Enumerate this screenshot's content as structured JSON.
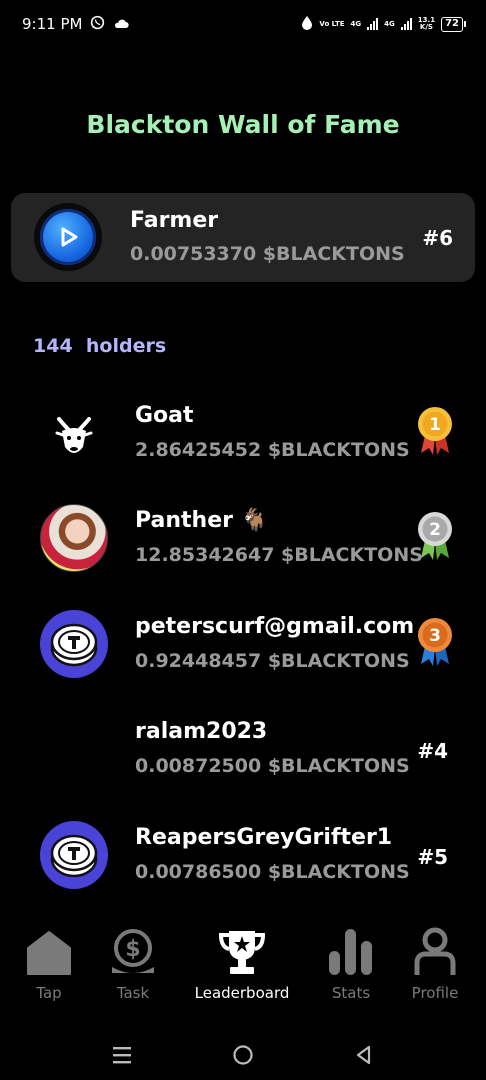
{
  "status_bar": {
    "time": "9:11 PM",
    "volte": "Vo LTE",
    "net1": "4G",
    "net2": "4G",
    "speed_value": "13.1",
    "speed_unit": "K/S",
    "battery": "72",
    "icons": [
      "whatsapp-icon",
      "cloud-icon",
      "data-saver-icon",
      "signal-icon",
      "battery-icon"
    ]
  },
  "page": {
    "title": "Blackton Wall of Fame"
  },
  "my_entry": {
    "name": "Farmer",
    "balance": "0.00753370 $BLACKTONS",
    "rank": "#6",
    "avatar": "blue-play-coin-avatar"
  },
  "holders": {
    "count": "144",
    "label": "holders"
  },
  "leaderboard": [
    {
      "name": "Goat",
      "balance": "2.86425452 $BLACKTONS",
      "rank": "1",
      "badge": "gold-medal-icon",
      "avatar": "goat-avatar"
    },
    {
      "name": "Panther 🐐",
      "balance": "12.85342647 $BLACKTONS",
      "rank": "2",
      "badge": "silver-medal-icon",
      "avatar": "photo-avatar"
    },
    {
      "name": "peterscurf@gmail.com",
      "balance": "0.92448457 $BLACKTONS",
      "rank": "3",
      "badge": "bronze-medal-icon",
      "avatar": "coin-avatar"
    },
    {
      "name": "ralam2023",
      "balance": "0.00872500 $BLACKTONS",
      "rank": "#4",
      "avatar": ""
    },
    {
      "name": "ReapersGreyGrifter1",
      "balance": "0.00786500 $BLACKTONS",
      "rank": "#5",
      "avatar": "coin-avatar"
    }
  ],
  "nav": {
    "items": [
      {
        "label": "Tap",
        "icon": "home-icon",
        "active": false
      },
      {
        "label": "Task",
        "icon": "dollar-coin-icon",
        "active": false
      },
      {
        "label": "Leaderboard",
        "icon": "trophy-icon",
        "active": true
      },
      {
        "label": "Stats",
        "icon": "bar-chart-icon",
        "active": false
      },
      {
        "label": "Profile",
        "icon": "person-icon",
        "active": false
      }
    ]
  },
  "colors": {
    "background": "#000000",
    "title": "#a6f0b5",
    "holders": "#b6b3ff",
    "card": "#242424",
    "muted": "#9a9a9a",
    "nav_inactive": "#7a7a7a"
  }
}
